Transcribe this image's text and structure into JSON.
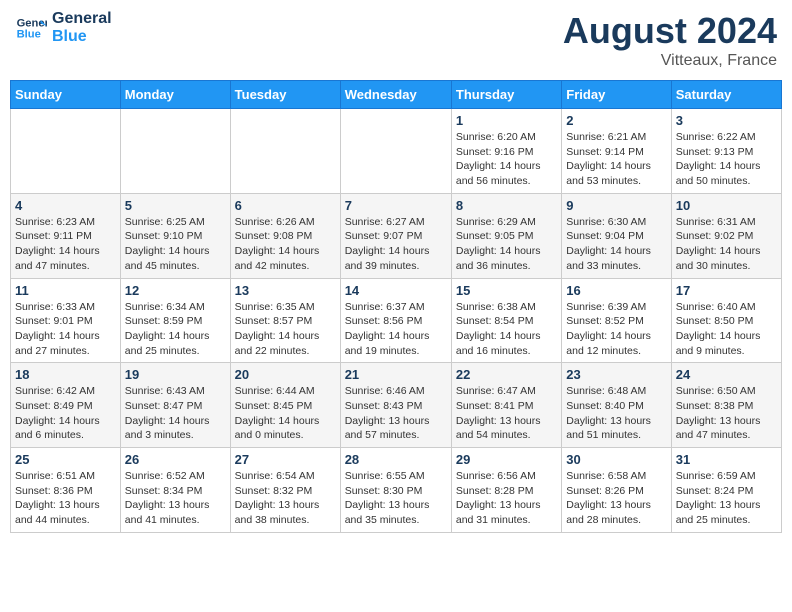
{
  "logo": {
    "line1": "General",
    "line2": "Blue"
  },
  "title": "August 2024",
  "location": "Vitteaux, France",
  "weekdays": [
    "Sunday",
    "Monday",
    "Tuesday",
    "Wednesday",
    "Thursday",
    "Friday",
    "Saturday"
  ],
  "weeks": [
    [
      {
        "day": "",
        "info": ""
      },
      {
        "day": "",
        "info": ""
      },
      {
        "day": "",
        "info": ""
      },
      {
        "day": "",
        "info": ""
      },
      {
        "day": "1",
        "info": "Sunrise: 6:20 AM\nSunset: 9:16 PM\nDaylight: 14 hours\nand 56 minutes."
      },
      {
        "day": "2",
        "info": "Sunrise: 6:21 AM\nSunset: 9:14 PM\nDaylight: 14 hours\nand 53 minutes."
      },
      {
        "day": "3",
        "info": "Sunrise: 6:22 AM\nSunset: 9:13 PM\nDaylight: 14 hours\nand 50 minutes."
      }
    ],
    [
      {
        "day": "4",
        "info": "Sunrise: 6:23 AM\nSunset: 9:11 PM\nDaylight: 14 hours\nand 47 minutes."
      },
      {
        "day": "5",
        "info": "Sunrise: 6:25 AM\nSunset: 9:10 PM\nDaylight: 14 hours\nand 45 minutes."
      },
      {
        "day": "6",
        "info": "Sunrise: 6:26 AM\nSunset: 9:08 PM\nDaylight: 14 hours\nand 42 minutes."
      },
      {
        "day": "7",
        "info": "Sunrise: 6:27 AM\nSunset: 9:07 PM\nDaylight: 14 hours\nand 39 minutes."
      },
      {
        "day": "8",
        "info": "Sunrise: 6:29 AM\nSunset: 9:05 PM\nDaylight: 14 hours\nand 36 minutes."
      },
      {
        "day": "9",
        "info": "Sunrise: 6:30 AM\nSunset: 9:04 PM\nDaylight: 14 hours\nand 33 minutes."
      },
      {
        "day": "10",
        "info": "Sunrise: 6:31 AM\nSunset: 9:02 PM\nDaylight: 14 hours\nand 30 minutes."
      }
    ],
    [
      {
        "day": "11",
        "info": "Sunrise: 6:33 AM\nSunset: 9:01 PM\nDaylight: 14 hours\nand 27 minutes."
      },
      {
        "day": "12",
        "info": "Sunrise: 6:34 AM\nSunset: 8:59 PM\nDaylight: 14 hours\nand 25 minutes."
      },
      {
        "day": "13",
        "info": "Sunrise: 6:35 AM\nSunset: 8:57 PM\nDaylight: 14 hours\nand 22 minutes."
      },
      {
        "day": "14",
        "info": "Sunrise: 6:37 AM\nSunset: 8:56 PM\nDaylight: 14 hours\nand 19 minutes."
      },
      {
        "day": "15",
        "info": "Sunrise: 6:38 AM\nSunset: 8:54 PM\nDaylight: 14 hours\nand 16 minutes."
      },
      {
        "day": "16",
        "info": "Sunrise: 6:39 AM\nSunset: 8:52 PM\nDaylight: 14 hours\nand 12 minutes."
      },
      {
        "day": "17",
        "info": "Sunrise: 6:40 AM\nSunset: 8:50 PM\nDaylight: 14 hours\nand 9 minutes."
      }
    ],
    [
      {
        "day": "18",
        "info": "Sunrise: 6:42 AM\nSunset: 8:49 PM\nDaylight: 14 hours\nand 6 minutes."
      },
      {
        "day": "19",
        "info": "Sunrise: 6:43 AM\nSunset: 8:47 PM\nDaylight: 14 hours\nand 3 minutes."
      },
      {
        "day": "20",
        "info": "Sunrise: 6:44 AM\nSunset: 8:45 PM\nDaylight: 14 hours\nand 0 minutes."
      },
      {
        "day": "21",
        "info": "Sunrise: 6:46 AM\nSunset: 8:43 PM\nDaylight: 13 hours\nand 57 minutes."
      },
      {
        "day": "22",
        "info": "Sunrise: 6:47 AM\nSunset: 8:41 PM\nDaylight: 13 hours\nand 54 minutes."
      },
      {
        "day": "23",
        "info": "Sunrise: 6:48 AM\nSunset: 8:40 PM\nDaylight: 13 hours\nand 51 minutes."
      },
      {
        "day": "24",
        "info": "Sunrise: 6:50 AM\nSunset: 8:38 PM\nDaylight: 13 hours\nand 47 minutes."
      }
    ],
    [
      {
        "day": "25",
        "info": "Sunrise: 6:51 AM\nSunset: 8:36 PM\nDaylight: 13 hours\nand 44 minutes."
      },
      {
        "day": "26",
        "info": "Sunrise: 6:52 AM\nSunset: 8:34 PM\nDaylight: 13 hours\nand 41 minutes."
      },
      {
        "day": "27",
        "info": "Sunrise: 6:54 AM\nSunset: 8:32 PM\nDaylight: 13 hours\nand 38 minutes."
      },
      {
        "day": "28",
        "info": "Sunrise: 6:55 AM\nSunset: 8:30 PM\nDaylight: 13 hours\nand 35 minutes."
      },
      {
        "day": "29",
        "info": "Sunrise: 6:56 AM\nSunset: 8:28 PM\nDaylight: 13 hours\nand 31 minutes."
      },
      {
        "day": "30",
        "info": "Sunrise: 6:58 AM\nSunset: 8:26 PM\nDaylight: 13 hours\nand 28 minutes."
      },
      {
        "day": "31",
        "info": "Sunrise: 6:59 AM\nSunset: 8:24 PM\nDaylight: 13 hours\nand 25 minutes."
      }
    ]
  ]
}
